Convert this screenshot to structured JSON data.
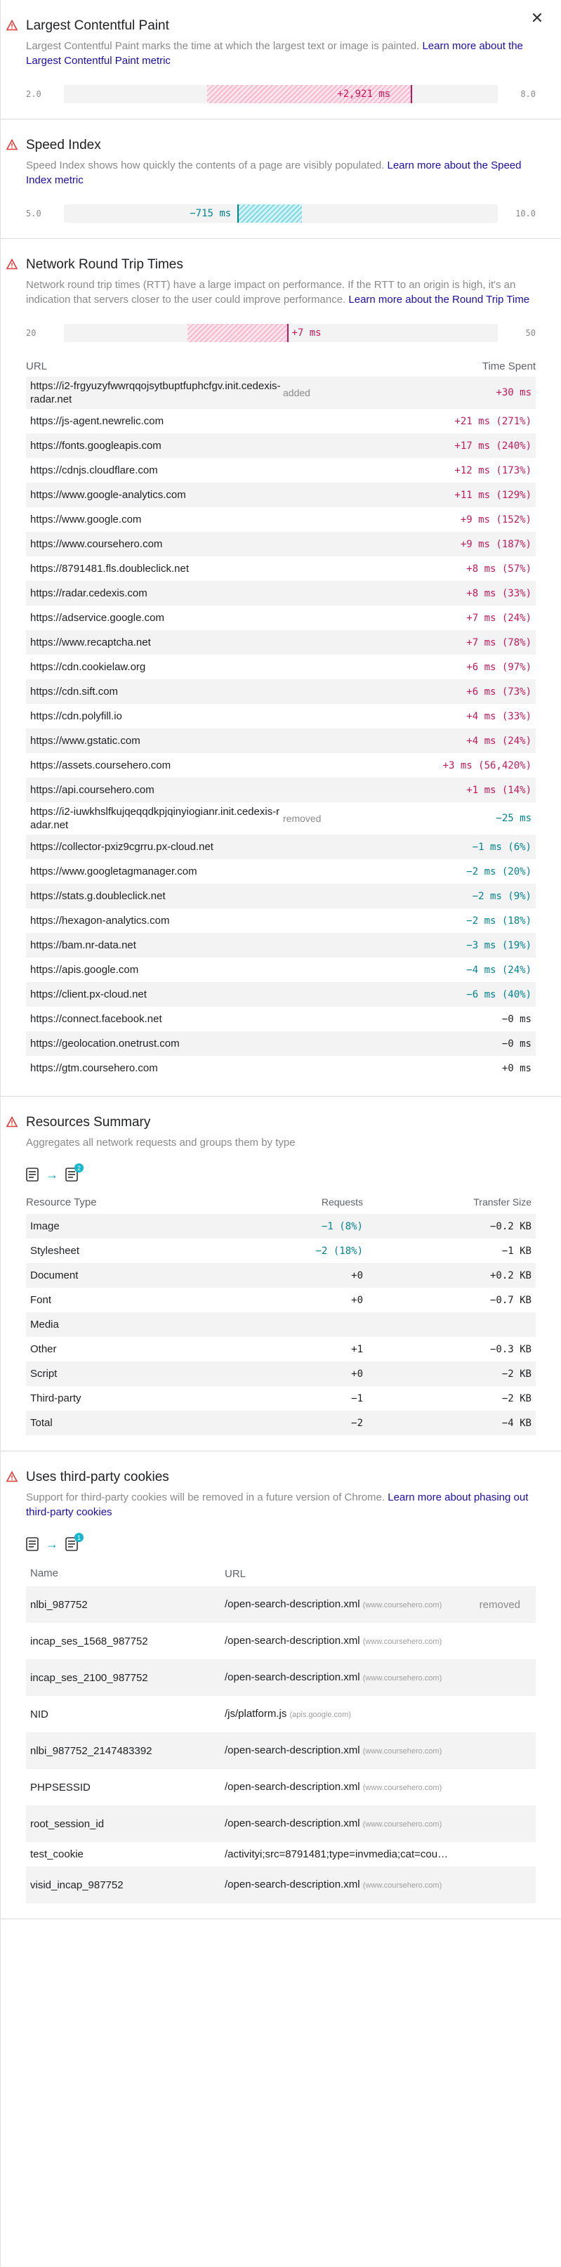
{
  "close_label": "✕",
  "colors": {
    "positive": "#c2185b",
    "negative": "#00838f",
    "warning": "#e53935",
    "link": "#1a0dab"
  },
  "lcp": {
    "title": "Largest Contentful Paint",
    "desc": "Largest Contentful Paint marks the time at which the largest text or image is painted.",
    "link": "Learn more about the Largest Contentful Paint metric",
    "axis_min": "2.0",
    "axis_max": "8.0",
    "delta_label": "+2,921 ms"
  },
  "si": {
    "title": "Speed Index",
    "desc": "Speed Index shows how quickly the contents of a page are visibly populated.",
    "link": "Learn more about the Speed Index metric",
    "axis_min": "5.0",
    "axis_max": "10.0",
    "delta_label": "−715 ms"
  },
  "rtt": {
    "title": "Network Round Trip Times",
    "desc": "Network round trip times (RTT) have a large impact on performance. If the RTT to an origin is high, it's an indication that servers closer to the user could improve performance.",
    "link": "Learn more about the Round Trip Time",
    "axis_min": "20",
    "axis_max": "50",
    "delta_label": "+7 ms",
    "col_url": "URL",
    "col_time": "Time Spent",
    "rows": [
      {
        "url": "https://i2-frgyuzyfwwrqqojsytbuptfuphcfgv.init.cedexis-radar.net",
        "tag": "added",
        "value": "+30 ms",
        "sign": "pos"
      },
      {
        "url": "https://js-agent.newrelic.com",
        "tag": "",
        "value": "+21 ms (271%)",
        "sign": "pos"
      },
      {
        "url": "https://fonts.googleapis.com",
        "tag": "",
        "value": "+17 ms (240%)",
        "sign": "pos"
      },
      {
        "url": "https://cdnjs.cloudflare.com",
        "tag": "",
        "value": "+12 ms (173%)",
        "sign": "pos"
      },
      {
        "url": "https://www.google-analytics.com",
        "tag": "",
        "value": "+11 ms (129%)",
        "sign": "pos"
      },
      {
        "url": "https://www.google.com",
        "tag": "",
        "value": "+9 ms (152%)",
        "sign": "pos"
      },
      {
        "url": "https://www.coursehero.com",
        "tag": "",
        "value": "+9 ms (187%)",
        "sign": "pos"
      },
      {
        "url": "https://8791481.fls.doubleclick.net",
        "tag": "",
        "value": "+8 ms (57%)",
        "sign": "pos"
      },
      {
        "url": "https://radar.cedexis.com",
        "tag": "",
        "value": "+8 ms (33%)",
        "sign": "pos"
      },
      {
        "url": "https://adservice.google.com",
        "tag": "",
        "value": "+7 ms (24%)",
        "sign": "pos"
      },
      {
        "url": "https://www.recaptcha.net",
        "tag": "",
        "value": "+7 ms (78%)",
        "sign": "pos"
      },
      {
        "url": "https://cdn.cookielaw.org",
        "tag": "",
        "value": "+6 ms (97%)",
        "sign": "pos"
      },
      {
        "url": "https://cdn.sift.com",
        "tag": "",
        "value": "+6 ms (73%)",
        "sign": "pos"
      },
      {
        "url": "https://cdn.polyfill.io",
        "tag": "",
        "value": "+4 ms (33%)",
        "sign": "pos"
      },
      {
        "url": "https://www.gstatic.com",
        "tag": "",
        "value": "+4 ms (24%)",
        "sign": "pos"
      },
      {
        "url": "https://assets.coursehero.com",
        "tag": "",
        "value": "+3 ms (56,420%)",
        "sign": "pos"
      },
      {
        "url": "https://api.coursehero.com",
        "tag": "",
        "value": "+1 ms (14%)",
        "sign": "pos"
      },
      {
        "url": "https://i2-iuwkhslfkujqeqqdkpjqinyiogianr.init.cedexis-radar.net",
        "tag": "removed",
        "value": "−25 ms",
        "sign": "neg"
      },
      {
        "url": "https://collector-pxiz9cgrru.px-cloud.net",
        "tag": "",
        "value": "−1 ms (6%)",
        "sign": "neg"
      },
      {
        "url": "https://www.googletagmanager.com",
        "tag": "",
        "value": "−2 ms (20%)",
        "sign": "neg"
      },
      {
        "url": "https://stats.g.doubleclick.net",
        "tag": "",
        "value": "−2 ms (9%)",
        "sign": "neg"
      },
      {
        "url": "https://hexagon-analytics.com",
        "tag": "",
        "value": "−2 ms (18%)",
        "sign": "neg"
      },
      {
        "url": "https://bam.nr-data.net",
        "tag": "",
        "value": "−3 ms (19%)",
        "sign": "neg"
      },
      {
        "url": "https://apis.google.com",
        "tag": "",
        "value": "−4 ms (24%)",
        "sign": "neg"
      },
      {
        "url": "https://client.px-cloud.net",
        "tag": "",
        "value": "−6 ms (40%)",
        "sign": "neg"
      },
      {
        "url": "https://connect.facebook.net",
        "tag": "",
        "value": "−0 ms",
        "sign": "zero"
      },
      {
        "url": "https://geolocation.onetrust.com",
        "tag": "",
        "value": "−0 ms",
        "sign": "zero"
      },
      {
        "url": "https://gtm.coursehero.com",
        "tag": "",
        "value": "+0 ms",
        "sign": "zero"
      }
    ]
  },
  "resources": {
    "title": "Resources Summary",
    "desc": "Aggregates all network requests and groups them by type",
    "badge": "2",
    "col_type": "Resource Type",
    "col_requests": "Requests",
    "col_size": "Transfer Size",
    "rows": [
      {
        "type": "Image",
        "requests": "−1 (8%)",
        "req_sign": "neg",
        "size": "−0.2 KB"
      },
      {
        "type": "Stylesheet",
        "requests": "−2 (18%)",
        "req_sign": "neg",
        "size": "−1 KB"
      },
      {
        "type": "Document",
        "requests": "+0",
        "req_sign": "zero",
        "size": "+0.2 KB"
      },
      {
        "type": "Font",
        "requests": "+0",
        "req_sign": "zero",
        "size": "−0.7 KB"
      },
      {
        "type": "Media",
        "requests": "",
        "req_sign": "zero",
        "size": ""
      },
      {
        "type": "Other",
        "requests": "+1",
        "req_sign": "zero",
        "size": "−0.3 KB"
      },
      {
        "type": "Script",
        "requests": "+0",
        "req_sign": "zero",
        "size": "−2 KB"
      },
      {
        "type": "Third-party",
        "requests": "−1",
        "req_sign": "zero",
        "size": "−2 KB"
      },
      {
        "type": "Total",
        "requests": "−2",
        "req_sign": "zero",
        "size": "−4 KB"
      }
    ]
  },
  "cookies": {
    "title": "Uses third-party cookies",
    "desc": "Support for third-party cookies will be removed in a future version of Chrome.",
    "link": "Learn more about phasing out third-party cookies",
    "badge": "1",
    "col_name": "Name",
    "col_url": "URL",
    "rows": [
      {
        "name": "nlbi_987752",
        "url": "/open-search-description.xml",
        "host": "(www.coursehero.com)",
        "tag": "removed"
      },
      {
        "name": "incap_ses_1568_987752",
        "url": "/open-search-description.xml",
        "host": "(www.coursehero.com)",
        "tag": ""
      },
      {
        "name": "incap_ses_2100_987752",
        "url": "/open-search-description.xml",
        "host": "(www.coursehero.com)",
        "tag": ""
      },
      {
        "name": "NID",
        "url": "/js/platform.js",
        "host": "(apis.google.com)",
        "tag": ""
      },
      {
        "name": "nlbi_987752_2147483392",
        "url": "/open-search-description.xml",
        "host": "(www.coursehero.com)",
        "tag": ""
      },
      {
        "name": "PHPSESSID",
        "url": "/open-search-description.xml",
        "host": "(www.coursehero.com)",
        "tag": ""
      },
      {
        "name": "root_session_id",
        "url": "/open-search-description.xml",
        "host": "(www.coursehero.com)",
        "tag": ""
      },
      {
        "name": "test_cookie",
        "url": "/activityi;src=8791481;type=invmedia;cat=cou…",
        "host": "",
        "tag": ""
      },
      {
        "name": "visid_incap_987752",
        "url": "/open-search-description.xml",
        "host": "(www.coursehero.com)",
        "tag": ""
      }
    ]
  }
}
